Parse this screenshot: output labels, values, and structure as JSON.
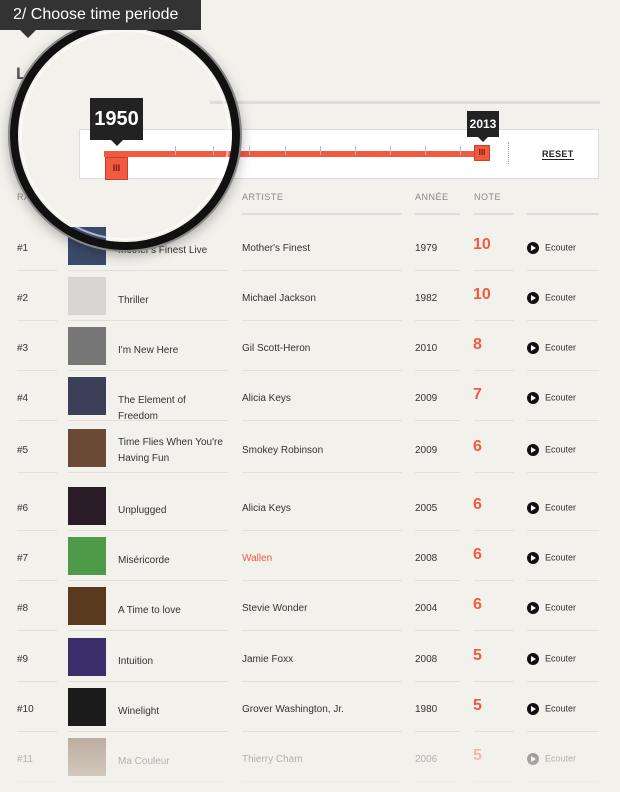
{
  "banner": {
    "label": "2/ Choose time periode"
  },
  "page": {
    "title": "Le"
  },
  "slider": {
    "min_label": "1950",
    "max_label": "2013",
    "handle_glyph": "III",
    "reset_label": "RESET",
    "range": {
      "from": 1950,
      "to": 2013
    }
  },
  "columns": {
    "rank": "RA",
    "artist": "ARTISTE",
    "year": "ANNÉE",
    "note": "NOTE"
  },
  "rows": [
    {
      "rank": "#1",
      "album": "Mother's Finest Live",
      "artist": "Mother's Finest",
      "year": "1979",
      "note": "10",
      "listen": "Ecouter",
      "cover_color": "#3a4a6a"
    },
    {
      "rank": "#2",
      "album": "Thriller",
      "artist": "Michael Jackson",
      "year": "1982",
      "note": "10",
      "listen": "Ecouter",
      "cover_color": "#d8d6d2"
    },
    {
      "rank": "#3",
      "album": "I'm New Here",
      "artist": "Gil Scott-Heron",
      "year": "2010",
      "note": "8",
      "listen": "Ecouter",
      "cover_color": "#777"
    },
    {
      "rank": "#4",
      "album": "The Element of Freedom",
      "artist": "Alicia Keys",
      "year": "2009",
      "note": "7",
      "listen": "Ecouter",
      "cover_color": "#3b3f57"
    },
    {
      "rank": "#5",
      "album": "Time Flies When You're Having Fun",
      "artist": "Smokey Robinson",
      "year": "2009",
      "note": "6",
      "listen": "Ecouter",
      "cover_color": "#6a4a36"
    },
    {
      "rank": "#6",
      "album": "Unplugged",
      "artist": "Alicia Keys",
      "year": "2005",
      "note": "6",
      "listen": "Ecouter",
      "cover_color": "#2a1c26"
    },
    {
      "rank": "#7",
      "album": "Miséricorde",
      "artist": "Wallen",
      "year": "2008",
      "note": "6",
      "listen": "Ecouter",
      "cover_color": "#4f9a48",
      "artist_color": "#f05a40"
    },
    {
      "rank": "#8",
      "album": "A Time to love",
      "artist": "Stevie Wonder",
      "year": "2004",
      "note": "6",
      "listen": "Ecouter",
      "cover_color": "#5a3a1e"
    },
    {
      "rank": "#9",
      "album": "Intuition",
      "artist": "Jamie Foxx",
      "year": "2008",
      "note": "5",
      "listen": "Ecouter",
      "cover_color": "#3a2f6a"
    },
    {
      "rank": "#10",
      "album": "Winelight",
      "artist": "Grover Washington, Jr.",
      "year": "1980",
      "note": "5",
      "listen": "Ecouter",
      "cover_color": "#1c1c1c"
    },
    {
      "rank": "#11",
      "album": "Ma Couleur",
      "artist": "Thierry Cham",
      "year": "2006",
      "note": "5",
      "listen": "Ecouter",
      "cover_color": "#7a5a44"
    }
  ],
  "colors": {
    "accent": "#f05a40",
    "dark": "#222222",
    "background": "#f3f1ec"
  }
}
